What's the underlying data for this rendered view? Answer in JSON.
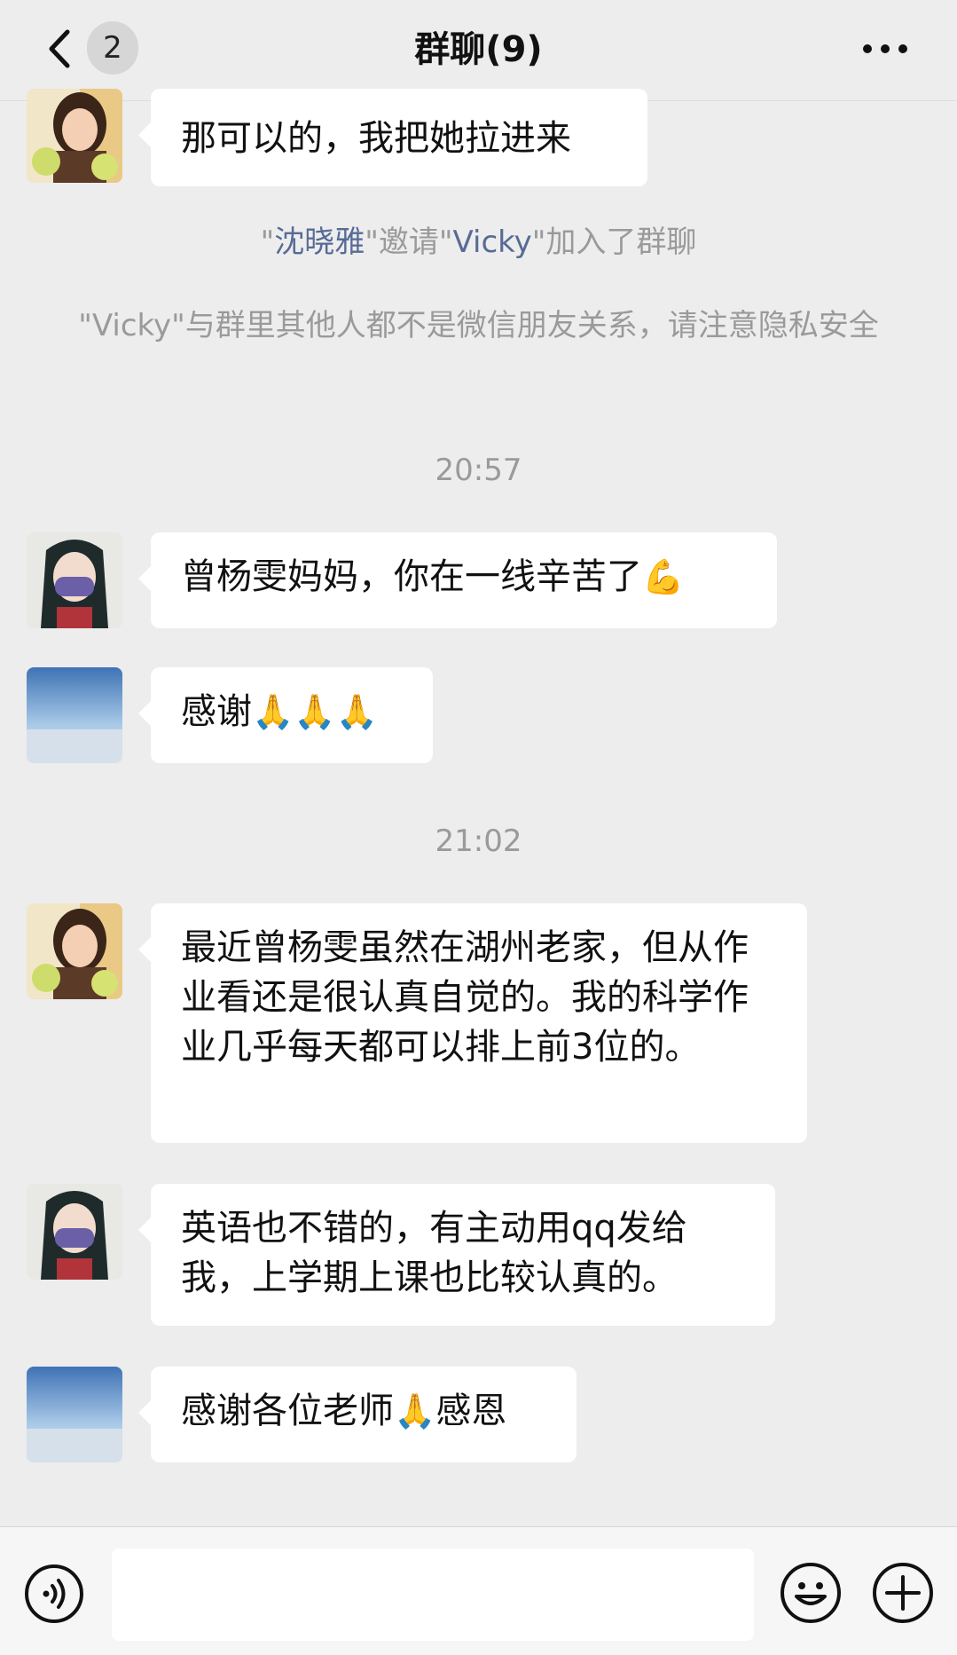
{
  "header": {
    "unread_count": "2",
    "title": "群聊(9)"
  },
  "messages": [
    {
      "type": "message",
      "avatar": "woman-with-apples-avatar",
      "text": "那可以的，我把她拉进来"
    },
    {
      "type": "system",
      "parts": [
        "\"",
        "沈晓雅",
        "\"邀请\"",
        "Vicky",
        "\"加入了群聊"
      ]
    },
    {
      "type": "system",
      "text": "\"Vicky\"与群里其他人都不是微信朋友关系，请注意隐私安全"
    },
    {
      "type": "time",
      "text": "20:57"
    },
    {
      "type": "message",
      "avatar": "masked-cartoon-girl-avatar",
      "text": "曾杨雯妈妈，你在一线辛苦了",
      "emoji": "strong-icon"
    },
    {
      "type": "message",
      "avatar": "sky-landscape-avatar",
      "text": "感谢",
      "emoji": "bow-hands-icon x3"
    },
    {
      "type": "time",
      "text": "21:02"
    },
    {
      "type": "message",
      "avatar": "woman-with-apples-avatar",
      "text": "最近曾杨雯虽然在湖州老家，但从作业看还是很认真自觉的。我的科学作业几乎每天都可以排上前3位的。"
    },
    {
      "type": "message",
      "avatar": "masked-cartoon-girl-avatar",
      "text": "英语也不错的，有主动用qq发给我，上学期上课也比较认真的。"
    },
    {
      "type": "message",
      "avatar": "sky-landscape-avatar",
      "text_before": "感谢各位老师",
      "text_after": "感恩",
      "emoji": "bow-hands-icon"
    }
  ],
  "colors": {
    "background": "#ededed",
    "bubble": "#ffffff",
    "system_text": "#9a9a9a",
    "name_link": "#576b95"
  }
}
